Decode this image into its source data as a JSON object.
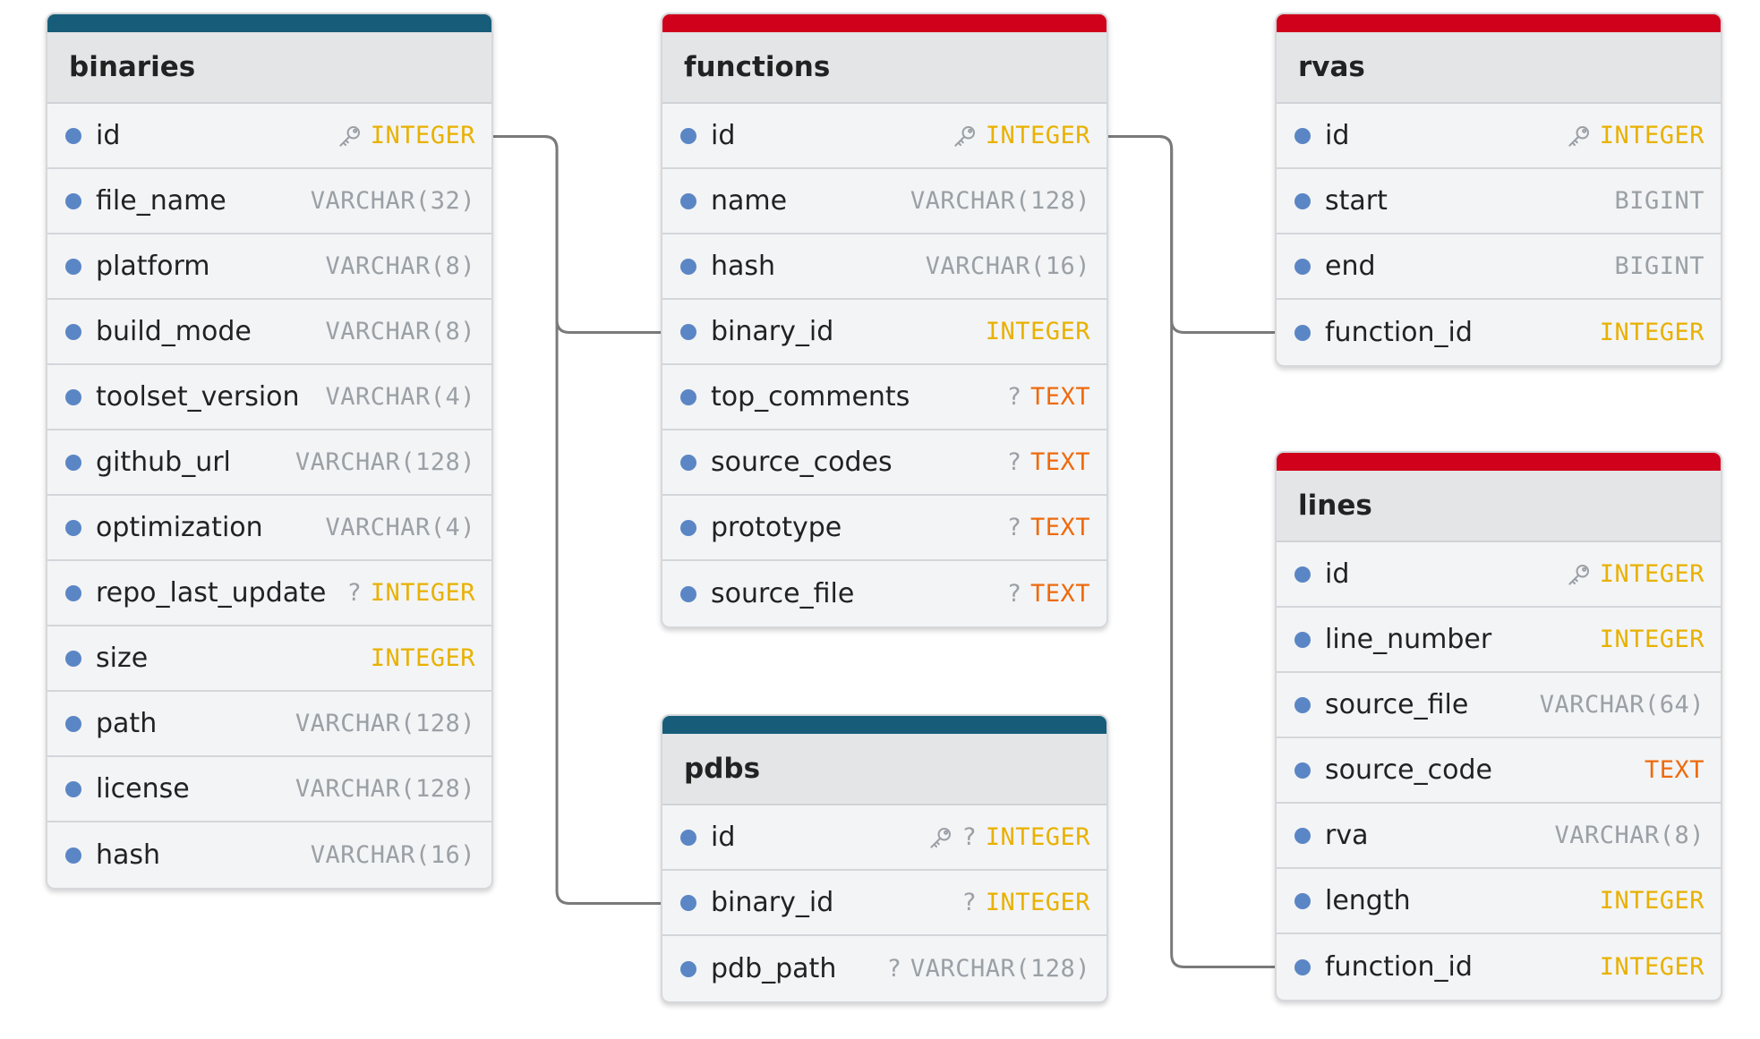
{
  "colors": {
    "primary_header_bar": "#175d7a",
    "secondary_header_bar": "#d0021b",
    "field_dot": "#5b86c5",
    "type_integer": "#e8b100",
    "type_text": "#ee6a0d",
    "type_other": "#9aa0a6",
    "link_line": "#7a7a7a"
  },
  "tables": {
    "binaries": {
      "name": "binaries",
      "fields": [
        {
          "name": "id",
          "type": "INTEGER",
          "pk": true,
          "nullable": false
        },
        {
          "name": "file_name",
          "type": "VARCHAR(32)",
          "pk": false,
          "nullable": false
        },
        {
          "name": "platform",
          "type": "VARCHAR(8)",
          "pk": false,
          "nullable": false
        },
        {
          "name": "build_mode",
          "type": "VARCHAR(8)",
          "pk": false,
          "nullable": false
        },
        {
          "name": "toolset_version",
          "type": "VARCHAR(4)",
          "pk": false,
          "nullable": false
        },
        {
          "name": "github_url",
          "type": "VARCHAR(128)",
          "pk": false,
          "nullable": false
        },
        {
          "name": "optimization",
          "type": "VARCHAR(4)",
          "pk": false,
          "nullable": false
        },
        {
          "name": "repo_last_update",
          "type": "INTEGER",
          "pk": false,
          "nullable": true
        },
        {
          "name": "size",
          "type": "INTEGER",
          "pk": false,
          "nullable": false
        },
        {
          "name": "path",
          "type": "VARCHAR(128)",
          "pk": false,
          "nullable": false
        },
        {
          "name": "license",
          "type": "VARCHAR(128)",
          "pk": false,
          "nullable": false
        },
        {
          "name": "hash",
          "type": "VARCHAR(16)",
          "pk": false,
          "nullable": false
        }
      ]
    },
    "functions": {
      "name": "functions",
      "fields": [
        {
          "name": "id",
          "type": "INTEGER",
          "pk": true,
          "nullable": false
        },
        {
          "name": "name",
          "type": "VARCHAR(128)",
          "pk": false,
          "nullable": false
        },
        {
          "name": "hash",
          "type": "VARCHAR(16)",
          "pk": false,
          "nullable": false
        },
        {
          "name": "binary_id",
          "type": "INTEGER",
          "pk": false,
          "nullable": false
        },
        {
          "name": "top_comments",
          "type": "TEXT",
          "pk": false,
          "nullable": true
        },
        {
          "name": "source_codes",
          "type": "TEXT",
          "pk": false,
          "nullable": true
        },
        {
          "name": "prototype",
          "type": "TEXT",
          "pk": false,
          "nullable": true
        },
        {
          "name": "source_file",
          "type": "TEXT",
          "pk": false,
          "nullable": true
        }
      ]
    },
    "pdbs": {
      "name": "pdbs",
      "fields": [
        {
          "name": "id",
          "type": "INTEGER",
          "pk": true,
          "nullable": true
        },
        {
          "name": "binary_id",
          "type": "INTEGER",
          "pk": false,
          "nullable": true
        },
        {
          "name": "pdb_path",
          "type": "VARCHAR(128)",
          "pk": false,
          "nullable": true
        }
      ]
    },
    "rvas": {
      "name": "rvas",
      "fields": [
        {
          "name": "id",
          "type": "INTEGER",
          "pk": true,
          "nullable": false
        },
        {
          "name": "start",
          "type": "BIGINT",
          "pk": false,
          "nullable": false
        },
        {
          "name": "end",
          "type": "BIGINT",
          "pk": false,
          "nullable": false
        },
        {
          "name": "function_id",
          "type": "INTEGER",
          "pk": false,
          "nullable": false
        }
      ]
    },
    "lines": {
      "name": "lines",
      "fields": [
        {
          "name": "id",
          "type": "INTEGER",
          "pk": true,
          "nullable": false
        },
        {
          "name": "line_number",
          "type": "INTEGER",
          "pk": false,
          "nullable": false
        },
        {
          "name": "source_file",
          "type": "VARCHAR(64)",
          "pk": false,
          "nullable": false
        },
        {
          "name": "source_code",
          "type": "TEXT",
          "pk": false,
          "nullable": false
        },
        {
          "name": "rva",
          "type": "VARCHAR(8)",
          "pk": false,
          "nullable": false
        },
        {
          "name": "length",
          "type": "INTEGER",
          "pk": false,
          "nullable": false
        },
        {
          "name": "function_id",
          "type": "INTEGER",
          "pk": false,
          "nullable": false
        }
      ]
    }
  },
  "relations": [
    {
      "from": "binaries.id",
      "to": "functions.binary_id"
    },
    {
      "from": "binaries.id",
      "to": "pdbs.binary_id"
    },
    {
      "from": "functions.id",
      "to": "rvas.function_id"
    },
    {
      "from": "functions.id",
      "to": "lines.function_id"
    }
  ]
}
